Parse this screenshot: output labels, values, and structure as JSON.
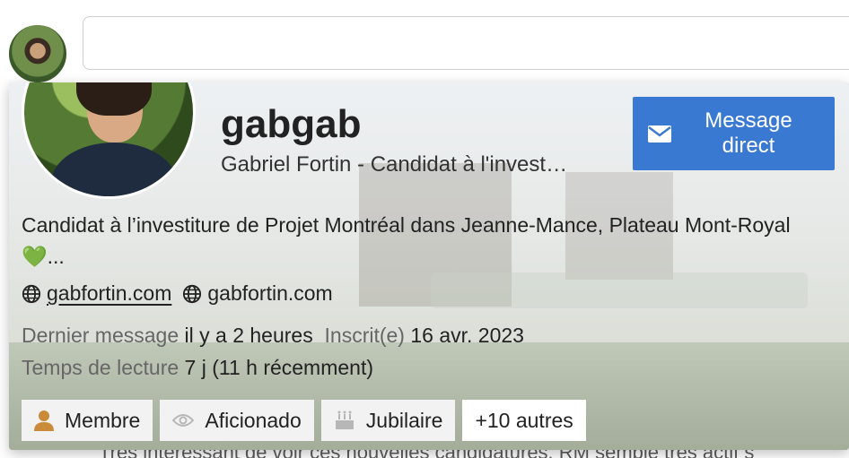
{
  "background": {
    "partial_text": "Très intéressant de voir ces nouvelles candidatures. RM semble très actif s"
  },
  "card": {
    "username": "gabgab",
    "full_name": "Gabriel Fortin - Candidat à l'invest…",
    "dm_button": {
      "line1": "Message",
      "line2": "direct",
      "icon": "envelope-icon"
    },
    "bio_text": "Candidat à l’investiture de Projet Montréal dans Jeanne-Mance, Plateau Mont-Royal",
    "bio_emoji": "💚",
    "bio_ellipsis": "...",
    "links": [
      {
        "icon": "globe-icon",
        "text": "gabfortin.com"
      },
      {
        "icon": "globe-icon",
        "text": "gabfortin.com"
      }
    ],
    "meta": {
      "last_post_label": "Dernier message",
      "last_post_value": "il y a 2 heures",
      "joined_label": "Inscrit(e)",
      "joined_value": "16 avr. 2023",
      "read_time_label": "Temps de lecture",
      "read_time_value": "7 j (11 h récemment)"
    },
    "badges": [
      {
        "label": "Membre",
        "icon": "user-icon",
        "color": "#c98a3a"
      },
      {
        "label": "Aficionado",
        "icon": "eye-icon",
        "color": "#b7b7b7"
      },
      {
        "label": "Jubilaire",
        "icon": "cake-icon",
        "color": "#b7b7b7"
      }
    ],
    "more_badges": "+10 autres"
  },
  "colors": {
    "accent": "#3a79d1",
    "bronze": "#c98a3a"
  }
}
